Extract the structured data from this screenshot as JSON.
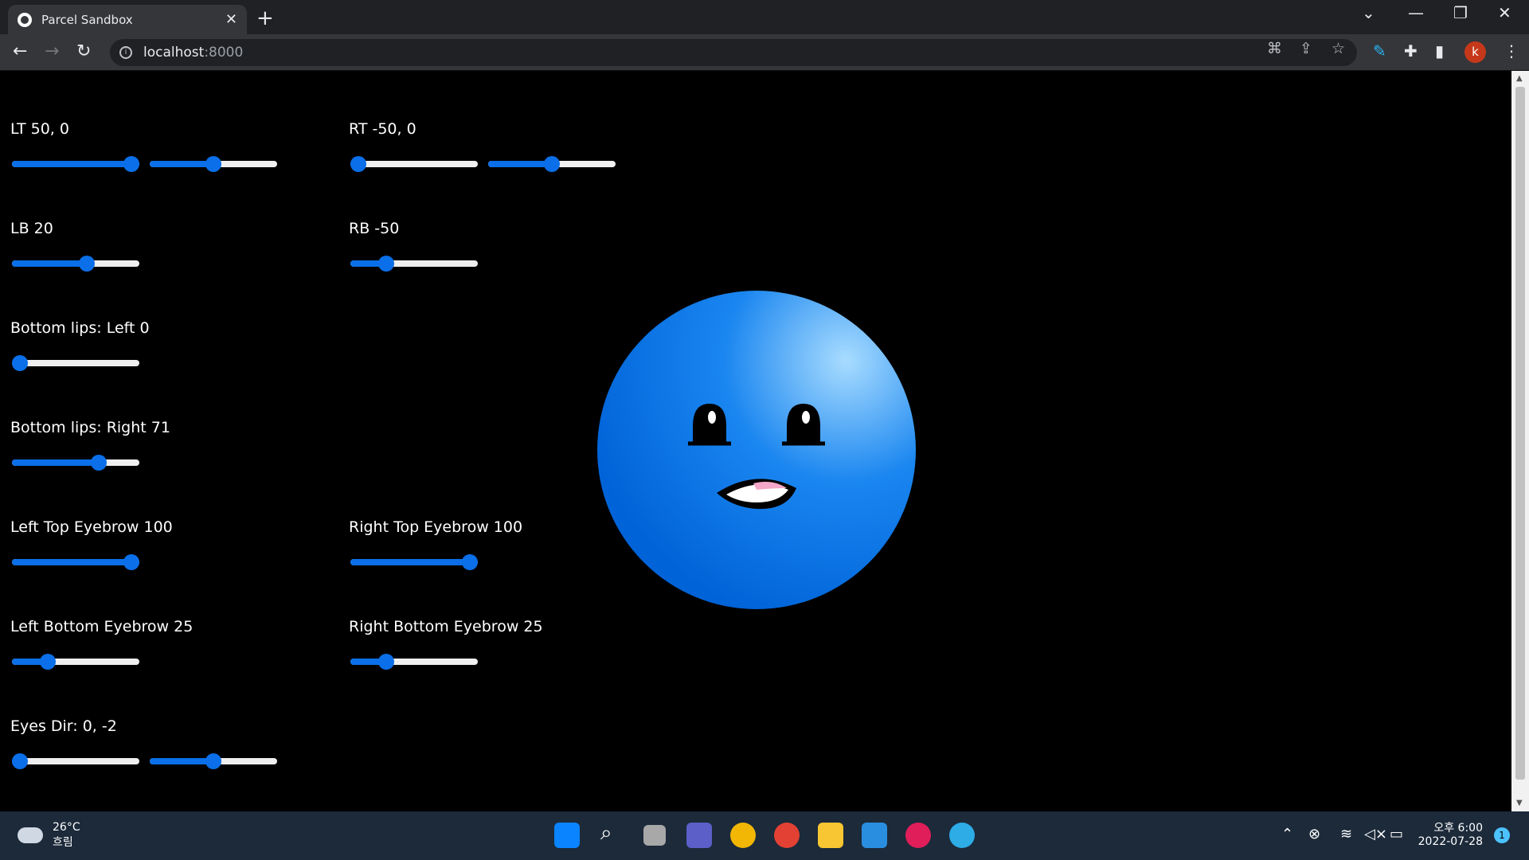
{
  "browser": {
    "tab_title": "Parcel Sandbox",
    "url_host": "localhost",
    "url_port": ":8000",
    "profile_initial": "k"
  },
  "controls": {
    "lt": {
      "label": "LT 50, 0",
      "sliders": [
        1.0,
        0.5
      ]
    },
    "rt": {
      "label": "RT -50, 0",
      "sliders": [
        0.0,
        0.5
      ]
    },
    "lb": {
      "label": "LB 20",
      "sliders": [
        0.6
      ]
    },
    "rb": {
      "label": "RB -50",
      "sliders": [
        0.25
      ]
    },
    "bottom_lips_left": {
      "label": "Bottom lips: Left 0",
      "sliders": [
        0.0
      ]
    },
    "bottom_lips_right": {
      "label": "Bottom lips: Right 71",
      "sliders": [
        0.71
      ]
    },
    "left_top_eyebrow": {
      "label": "Left Top Eyebrow 100",
      "sliders": [
        1.0
      ]
    },
    "right_top_eyebrow": {
      "label": "Right Top Eyebrow 100",
      "sliders": [
        1.0
      ]
    },
    "left_bottom_eyebrow": {
      "label": "Left Bottom Eyebrow 25",
      "sliders": [
        0.25
      ]
    },
    "right_bottom_eyebrow": {
      "label": "Right Bottom Eyebrow 25",
      "sliders": [
        0.25
      ]
    },
    "eyes_dir": {
      "label": "Eyes Dir: 0, -2",
      "sliders": [
        0.0,
        0.5
      ]
    }
  },
  "face": {
    "color_light": "#a8dcff",
    "color_mid": "#1a86f0",
    "color_dark": "#0063d8"
  },
  "taskbar": {
    "temperature": "26°C",
    "weather": "흐림",
    "time": "오후 6:00",
    "date": "2022-07-28",
    "notification_count": "1"
  }
}
